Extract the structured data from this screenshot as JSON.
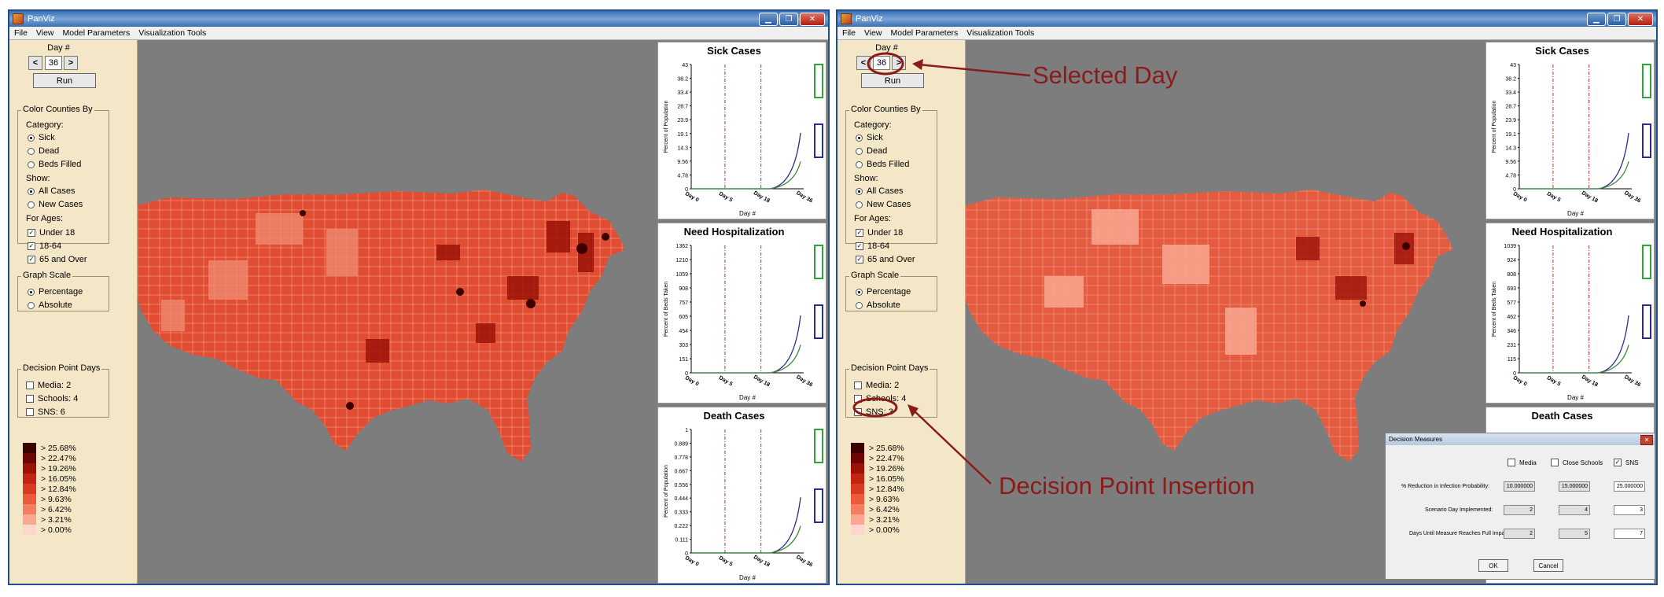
{
  "app": {
    "title": "PanViz",
    "menu": [
      "File",
      "View",
      "Model Parameters",
      "Visualization Tools"
    ]
  },
  "left_panel": {
    "day_label": "Day #",
    "prev": "<",
    "next": ">",
    "run": "Run",
    "color_group": "Color Counties By",
    "category_label": "Category:",
    "categories": [
      "Sick",
      "Dead",
      "Beds Filled"
    ],
    "show_label": "Show:",
    "show_options": [
      "All Cases",
      "New Cases"
    ],
    "ages_label": "For Ages:",
    "ages": [
      "Under 18",
      "18-64",
      "65 and Over"
    ],
    "scale_group": "Graph Scale",
    "scales": [
      "Percentage",
      "Absolute"
    ],
    "decision_group": "Decision Point Days",
    "legend": [
      "> 25.68%",
      "> 22.47%",
      "> 19.26%",
      "> 16.05%",
      "> 12.84%",
      "> 9.63%",
      "> 6.42%",
      "> 3.21%",
      "> 0.00%"
    ]
  },
  "colors": {
    "legend": [
      "#3d0000",
      "#6e0505",
      "#9c1208",
      "#c12512",
      "#da3a22",
      "#ec5a3c",
      "#f47e62",
      "#f9a790",
      "#fdd7cb"
    ],
    "map_bg": "#7d7d7d",
    "panel": "#f4e7c7",
    "annotation": "#8b1a1a"
  },
  "screens": [
    {
      "day": "36",
      "decision_points": [
        "Media: 2",
        "Schools: 4",
        "SNS: 6"
      ],
      "graphs": [
        {
          "title": "Sick Cases",
          "ylabel": "Percent of Population",
          "yticks": [
            "43",
            "38.2",
            "33.4",
            "28.7",
            "23.9",
            "19.1",
            "14.3",
            "9.56",
            "4.78",
            "0"
          ]
        },
        {
          "title": "Need Hospitalization",
          "ylabel": "Percent of Beds Taken",
          "yticks": [
            "1362",
            "1210",
            "1059",
            "908",
            "757",
            "605",
            "454",
            "303",
            "151",
            "0"
          ]
        },
        {
          "title": "Death Cases",
          "ylabel": "Percent of Population",
          "yticks": [
            "1",
            "0.889",
            "0.778",
            "0.667",
            "0.556",
            "0.444",
            "0.333",
            "0.222",
            "0.111",
            "0"
          ]
        }
      ]
    },
    {
      "day": "36",
      "decision_points": [
        "Media: 2",
        "Schools: 4",
        "SNS: 3"
      ],
      "graphs": [
        {
          "title": "Sick Cases",
          "ylabel": "Percent of Population",
          "yticks": [
            "43",
            "38.2",
            "33.4",
            "28.7",
            "23.9",
            "19.1",
            "14.3",
            "9.56",
            "4.78",
            "0"
          ]
        },
        {
          "title": "Need Hospitalization",
          "ylabel": "Percent of Beds Taken",
          "yticks": [
            "1039",
            "924",
            "808",
            "693",
            "577",
            "462",
            "346",
            "231",
            "115",
            "0"
          ]
        },
        {
          "title": "Death Cases",
          "ylabel": "",
          "yticks": []
        }
      ]
    }
  ],
  "graph_common": {
    "xlabel": "Day #",
    "xticks": [
      "Day 0",
      "Day 5",
      "Day 18",
      "Day 36"
    ]
  },
  "annotations": {
    "selected_day": "Selected Day",
    "decision_insertion": "Decision Point Insertion"
  },
  "dialog": {
    "title": "Decision Measures",
    "measures": [
      "Media",
      "Close Schools",
      "SNS"
    ],
    "measures_checked": [
      false,
      false,
      true
    ],
    "row_labels": [
      "% Reduction in Infection Probability:",
      "Scenario Day Implemented:",
      "Days Until Measure Reaches Full Impact:"
    ],
    "reduction": [
      "10.000000",
      "15.000000",
      "25.000000"
    ],
    "day_implemented": [
      "2",
      "4",
      "3"
    ],
    "days_full": [
      "2",
      "5",
      "7"
    ],
    "ok": "OK",
    "cancel": "Cancel"
  }
}
